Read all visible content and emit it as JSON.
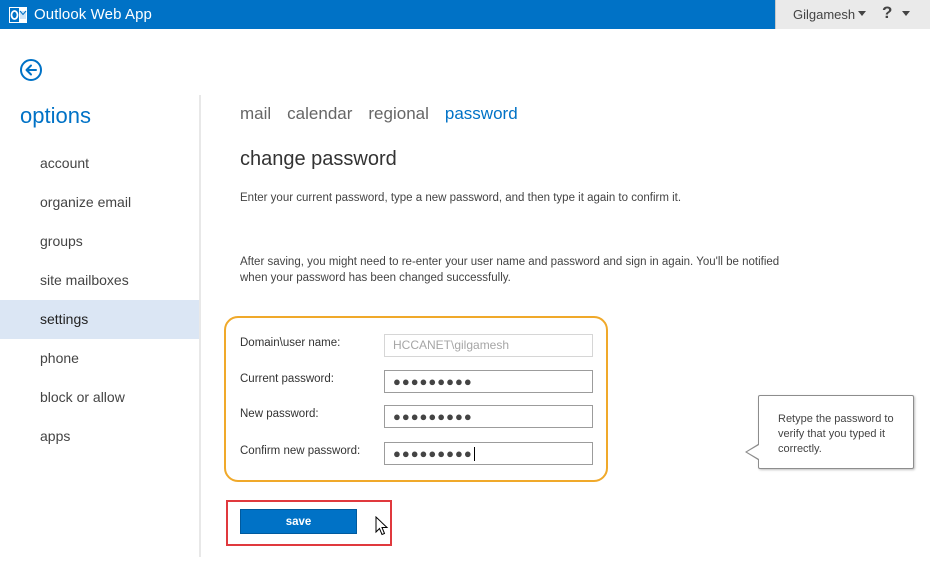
{
  "app": {
    "title": "Outlook Web App"
  },
  "header": {
    "username": "Gilgamesh",
    "help_glyph": "?"
  },
  "nav": {
    "title": "options",
    "items": [
      {
        "label": "account"
      },
      {
        "label": "organize email"
      },
      {
        "label": "groups"
      },
      {
        "label": "site mailboxes"
      },
      {
        "label": "settings",
        "active": true
      },
      {
        "label": "phone"
      },
      {
        "label": "block or allow"
      },
      {
        "label": "apps"
      }
    ]
  },
  "tabs": [
    {
      "label": "mail"
    },
    {
      "label": "calendar"
    },
    {
      "label": "regional"
    },
    {
      "label": "password",
      "active": true
    }
  ],
  "section": {
    "title": "change password",
    "instructions": "Enter your current password, type a new password, and then type it again to confirm it.",
    "note": "After saving, you might need to re-enter your user name and password and sign in again. You'll be notified when your password has been changed successfully."
  },
  "form": {
    "domain_label": "Domain\\user name:",
    "domain_value": "HCCANET\\gilgamesh",
    "current_label": "Current password:",
    "current_value": "●●●●●●●●●",
    "new_label": "New password:",
    "new_value": "●●●●●●●●●",
    "confirm_label": "Confirm new password:",
    "confirm_value": "●●●●●●●●●"
  },
  "tooltip": {
    "text": "Retype the password to verify that you typed it correctly."
  },
  "actions": {
    "save_label": "save"
  },
  "colors": {
    "accent": "#0072c6",
    "highlight_orange": "#f0a92a",
    "highlight_red": "#e0393e",
    "nav_active_bg": "#dbe6f4"
  }
}
